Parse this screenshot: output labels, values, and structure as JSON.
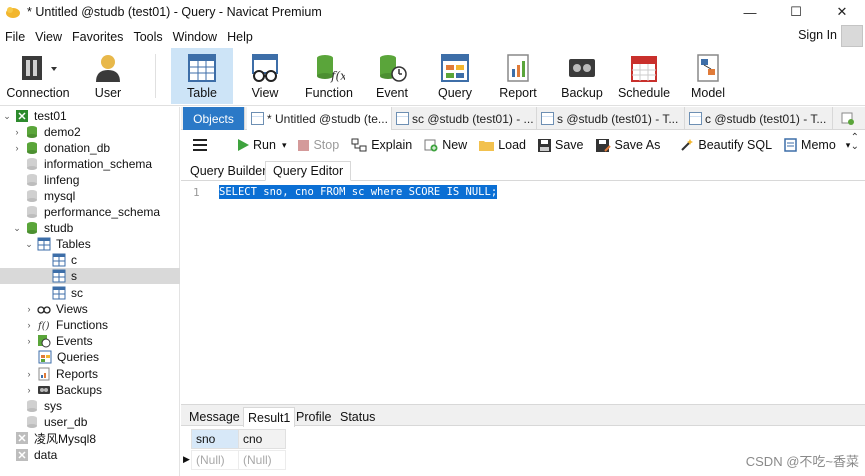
{
  "window": {
    "title": "* Untitled @studb (test01) - Query - Navicat Premium",
    "controls": [
      "minimize",
      "maximize",
      "close"
    ]
  },
  "menu": [
    "File",
    "View",
    "Favorites",
    "Tools",
    "Window",
    "Help"
  ],
  "account": {
    "signin": "Sign In"
  },
  "toolbar": [
    {
      "label": "Connection",
      "icon": "connection-icon"
    },
    {
      "label": "User",
      "icon": "user-icon"
    },
    {
      "label": "Table",
      "icon": "table-icon",
      "active": true
    },
    {
      "label": "View",
      "icon": "view-icon"
    },
    {
      "label": "Function",
      "icon": "function-icon"
    },
    {
      "label": "Event",
      "icon": "event-icon"
    },
    {
      "label": "Query",
      "icon": "query-icon"
    },
    {
      "label": "Report",
      "icon": "report-icon"
    },
    {
      "label": "Backup",
      "icon": "backup-icon"
    },
    {
      "label": "Schedule",
      "icon": "schedule-icon"
    },
    {
      "label": "Model",
      "icon": "model-icon"
    }
  ],
  "tree": [
    {
      "label": "test01",
      "level": 0,
      "caret": "v",
      "icon": "connection-icon"
    },
    {
      "label": "demo2",
      "level": 1,
      "caret": ">",
      "icon": "database-icon"
    },
    {
      "label": "donation_db",
      "level": 1,
      "caret": ">",
      "icon": "database-icon"
    },
    {
      "label": "information_schema",
      "level": 1,
      "caret": "",
      "icon": "database-closed-icon"
    },
    {
      "label": "linfeng",
      "level": 1,
      "caret": "",
      "icon": "database-closed-icon"
    },
    {
      "label": "mysql",
      "level": 1,
      "caret": "",
      "icon": "database-closed-icon"
    },
    {
      "label": "performance_schema",
      "level": 1,
      "caret": "",
      "icon": "database-closed-icon"
    },
    {
      "label": "studb",
      "level": 1,
      "caret": "v",
      "icon": "database-icon"
    },
    {
      "label": "Tables",
      "level": 2,
      "caret": "v",
      "icon": "tables-icon"
    },
    {
      "label": "c",
      "level": 3,
      "caret": "",
      "icon": "table-icon"
    },
    {
      "label": "s",
      "level": 3,
      "caret": "",
      "icon": "table-icon",
      "selected": true
    },
    {
      "label": "sc",
      "level": 3,
      "caret": "",
      "icon": "table-icon"
    },
    {
      "label": "Views",
      "level": 2,
      "caret": ">",
      "icon": "views-icon"
    },
    {
      "label": "Functions",
      "level": 2,
      "caret": ">",
      "icon": "functions-icon"
    },
    {
      "label": "Events",
      "level": 2,
      "caret": ">",
      "icon": "events-icon"
    },
    {
      "label": "Queries",
      "level": 2,
      "caret": "",
      "icon": "queries-icon"
    },
    {
      "label": "Reports",
      "level": 2,
      "caret": ">",
      "icon": "reports-icon"
    },
    {
      "label": "Backups",
      "level": 2,
      "caret": ">",
      "icon": "backups-icon"
    },
    {
      "label": "sys",
      "level": 1,
      "caret": "",
      "icon": "database-closed-icon"
    },
    {
      "label": "user_db",
      "level": 1,
      "caret": "",
      "icon": "database-closed-icon"
    },
    {
      "label": "凌风Mysql8",
      "level": 0,
      "caret": "",
      "icon": "connection-closed-icon"
    },
    {
      "label": "data",
      "level": 0,
      "caret": "",
      "icon": "connection-closed-icon"
    }
  ],
  "tabs": [
    {
      "label": "Objects"
    },
    {
      "label": "* Untitled @studb (te..."
    },
    {
      "label": "sc @studb (test01) - ..."
    },
    {
      "label": "s @studb (test01) - T..."
    },
    {
      "label": "c @studb (test01) - T..."
    }
  ],
  "query_toolbar": {
    "run": "Run",
    "stop": "Stop",
    "explain": "Explain",
    "new": "New",
    "load": "Load",
    "save": "Save",
    "save_as": "Save As",
    "beautify": "Beautify SQL",
    "memo": "Memo"
  },
  "editor_tabs": [
    "Query Builder",
    "Query Editor"
  ],
  "editor": {
    "line_number": "1",
    "sql": "SELECT sno, cno FROM sc where SCORE IS NULL;"
  },
  "result_tabs": [
    "Message",
    "Result1",
    "Profile",
    "Status"
  ],
  "result": {
    "columns": [
      "sno",
      "cno"
    ],
    "rows": [
      [
        "(Null)",
        "(Null)"
      ]
    ]
  },
  "watermark": "CSDN @不吃~香菜",
  "colors": {
    "accent": "#2b79c7",
    "selection": "#0b6fd4",
    "active_tool": "#cde4f7"
  }
}
